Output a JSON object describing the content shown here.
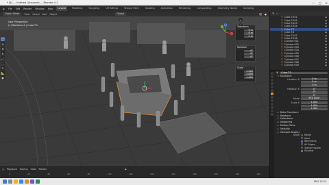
{
  "window": {
    "title": "*  [4] — Untitled (Unsaved) — Blender 4.1"
  },
  "menu": [
    "File",
    "Edit",
    "Render",
    "Window",
    "Help"
  ],
  "workspaces": [
    {
      "label": "Layout",
      "active": true
    },
    {
      "label": "Modeling",
      "active": false
    },
    {
      "label": "Sculpting",
      "active": false
    },
    {
      "label": "UV Editing",
      "active": false
    },
    {
      "label": "Texture Paint",
      "active": false
    },
    {
      "label": "Shading",
      "active": false
    },
    {
      "label": "Animation",
      "active": false
    },
    {
      "label": "Rendering",
      "active": false
    },
    {
      "label": "Compositing",
      "active": false
    },
    {
      "label": "Geometry Nodes",
      "active": false
    },
    {
      "label": "Scripting",
      "active": false
    }
  ],
  "header": {
    "mode": "Object Mode",
    "view": "View",
    "select": "Select",
    "add": "Add",
    "object": "Object",
    "orientation": "Global"
  },
  "viewport": {
    "info_line1": "User Perspective",
    "info_line2": "(1) Workbench | Cube.T.5",
    "info_line3": ""
  },
  "gizmo": {
    "x": "X",
    "y": "Y",
    "z": "Z"
  },
  "npanel": {
    "transform": {
      "title": "Transform",
      "fields": [
        {
          "label": "",
          "value": "0 m"
        },
        {
          "label": "",
          "value": "0 m"
        },
        {
          "label": "",
          "value": "0 m"
        }
      ]
    },
    "rotation": {
      "title": "Rotation",
      "fields": [
        {
          "label": "",
          "value": "0°"
        },
        {
          "label": "",
          "value": "0°"
        },
        {
          "label": "",
          "value": "0°"
        }
      ]
    },
    "scale": {
      "title": "Scale",
      "fields": [
        {
          "label": "",
          "value": "1.000"
        },
        {
          "label": "",
          "value": "1.000"
        },
        {
          "label": "",
          "value": "1.000"
        }
      ]
    }
  },
  "outliner": {
    "items": [
      {
        "name": "Cube.T.001",
        "selected": false
      },
      {
        "name": "Cube.T.002",
        "selected": false
      },
      {
        "name": "Cube.T.003",
        "selected": false
      },
      {
        "name": "Cube.T.004",
        "selected": false
      },
      {
        "name": "Cube.T.5",
        "selected": true
      },
      {
        "name": "Cube.T.6",
        "selected": false
      },
      {
        "name": "Cube.T.007",
        "selected": false
      },
      {
        "name": "Cube.T.008",
        "selected": false
      },
      {
        "name": "Cylinder.001",
        "selected": false
      },
      {
        "name": "Cylinder.002",
        "selected": false
      },
      {
        "name": "Cylinder.003",
        "selected": false
      },
      {
        "name": "Cylinder.004",
        "selected": false
      },
      {
        "name": "Cylinder.005",
        "selected": false
      },
      {
        "name": "Cylinder.006",
        "selected": false
      },
      {
        "name": "Cylinder.007",
        "selected": false
      },
      {
        "name": "Cylinder.008",
        "selected": false
      },
      {
        "name": "Cylinder.009",
        "selected": false
      }
    ]
  },
  "properties": {
    "object_name": "Cube.T.5",
    "transform_title": "Transform",
    "location": {
      "label": "Location X",
      "x": "0 m",
      "y": "0 m",
      "z": "0 m"
    },
    "rotation": {
      "label": "Rotation X",
      "x": "0°",
      "y": "0°",
      "z": "0°"
    },
    "mode": {
      "label": "Mode",
      "value": "XYZ Euler"
    },
    "scale": {
      "label": "Scale X",
      "x": "1.000",
      "y": "1.000",
      "z": "1.000"
    },
    "sections": [
      "Delta Transform",
      "Relations",
      "Collections",
      "Instancing",
      "Motion Paths",
      "Visibility",
      "Viewport Display"
    ],
    "display": [
      {
        "label": "Show",
        "value": "Name",
        "on": false
      },
      {
        "label": "",
        "value": "Axes",
        "on": false
      },
      {
        "label": "",
        "value": "Wireframe",
        "on": true
      },
      {
        "label": "",
        "value": "All Edges",
        "on": false
      },
      {
        "label": "",
        "value": "Texture Space",
        "on": false
      },
      {
        "label": "",
        "value": "Shadow",
        "on": true
      }
    ]
  },
  "timeline": {
    "playback": "Playback",
    "keying": "Keying",
    "view": "View",
    "marker": "Marker",
    "ticks": [
      "0",
      "20",
      "40",
      "60",
      "80",
      "100",
      "120",
      "140",
      "160",
      "180",
      "200",
      "220",
      "240"
    ]
  },
  "status": {
    "tray": "ENG 10:24"
  },
  "colors": {
    "accent": "#4772b3",
    "selection": "#e08a2c",
    "bg": "#3a3a3a"
  }
}
